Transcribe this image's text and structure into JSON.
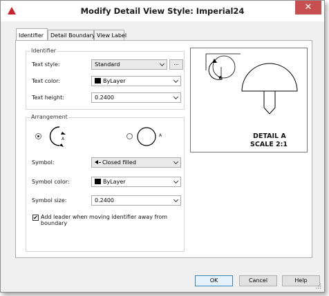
{
  "window": {
    "title": "Modify Detail View Style: Imperial24",
    "close_glyph": "✕"
  },
  "tabs": [
    {
      "label": "Identifier",
      "active": true
    },
    {
      "label": "Detail Boundary",
      "active": false
    },
    {
      "label": "View Label",
      "active": false
    }
  ],
  "identifier": {
    "group_title": "Identifier",
    "text_style_label": "Text style:",
    "text_style_value": "Standard",
    "browse_label": "...",
    "text_color_label": "Text color:",
    "text_color_value": "ByLayer",
    "text_height_label": "Text height:",
    "text_height_value": "0.2400"
  },
  "arrangement": {
    "group_title": "Arrangement",
    "option1_letter": "A",
    "option2_letter": "A",
    "symbol_label": "Symbol:",
    "symbol_value": "Closed filled",
    "symbol_color_label": "Symbol color:",
    "symbol_color_value": "ByLayer",
    "symbol_size_label": "Symbol size:",
    "symbol_size_value": "0.2400",
    "leader_checkbox_label_line1": "Add leader when moving identifier away from",
    "leader_checkbox_label_line2": "boundary",
    "leader_checked": true
  },
  "preview": {
    "caption_line1": "DETAIL A",
    "caption_line2": "SCALE 2:1"
  },
  "buttons": {
    "ok": "OK",
    "cancel": "Cancel",
    "help": "Help"
  },
  "colors": {
    "accent_red": "#c8232c",
    "close_bg": "#c74f50",
    "ok_border": "#3c7fb1"
  }
}
